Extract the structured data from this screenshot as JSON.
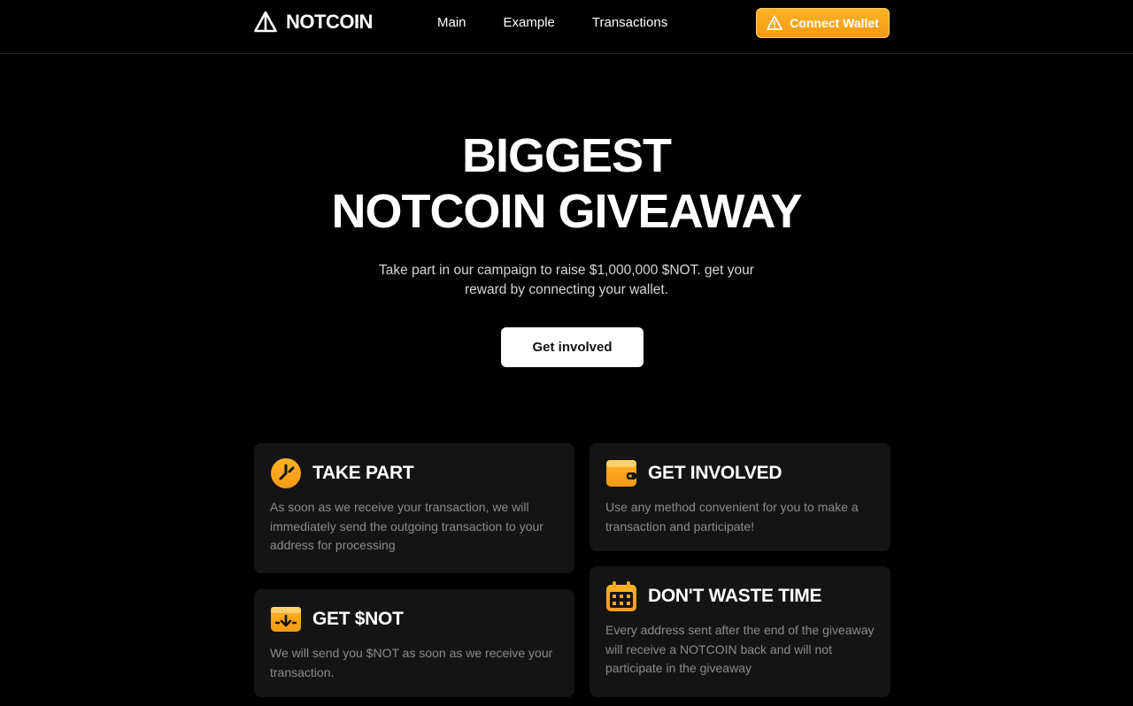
{
  "brand": {
    "name": "NOTCOIN",
    "icon": "triangle-logo-icon"
  },
  "nav": {
    "items": [
      "Main",
      "Example",
      "Transactions"
    ]
  },
  "wallet_button": {
    "label": "Connect Wallet",
    "icon": "warning-triangle-icon"
  },
  "hero": {
    "title_line1": "BIGGEST",
    "title_line2": "NOTCOIN GIVEAWAY",
    "subtitle": "Take part in our campaign to raise $1,000,000 $NOT. get your reward by connecting your wallet.",
    "cta_label": "Get involved"
  },
  "cards": [
    {
      "title": "TAKE PART",
      "icon": "clock-icon",
      "text": "As soon as we receive your transaction, we will immediately send the outgoing transaction to your address for processing"
    },
    {
      "title": "GET INVOLVED",
      "icon": "wallet-icon",
      "text": "Use any method convenient for you to make a transaction and participate!"
    },
    {
      "title": "GET $NOT",
      "icon": "receive-icon",
      "text": "We will send you $NOT as soon as we receive your transaction."
    },
    {
      "title": "DON'T WASTE TIME",
      "icon": "calendar-icon",
      "text": "Every address sent after the end of the giveaway will receive a NOTCOIN back and will not participate in the giveaway"
    }
  ],
  "colors": {
    "accent": "#f7a41d",
    "background": "#000000",
    "card": "#141414",
    "muted_text": "#8c8c8c"
  }
}
